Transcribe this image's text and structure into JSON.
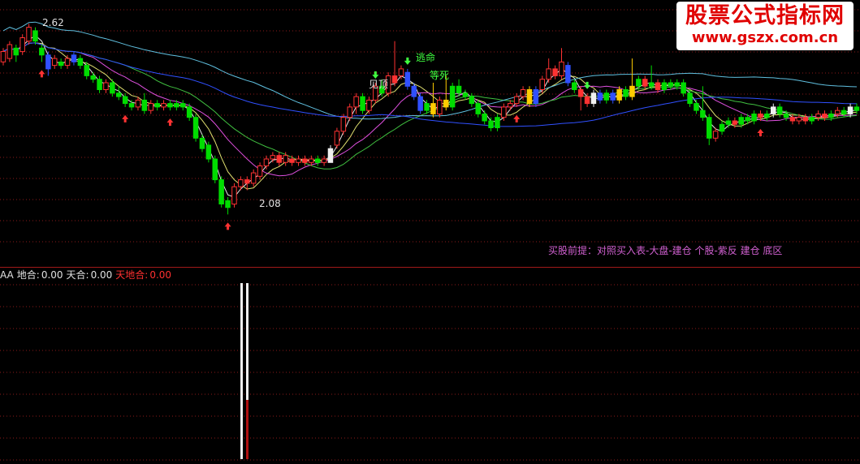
{
  "colors": {
    "up": "#ff3232",
    "down": "#00dd00",
    "grid": "#8b1a1a",
    "ma_white": "#e8e8e8",
    "ma_yellow": "#e0e070",
    "ma_magenta": "#e050e0",
    "ma_green": "#40c040",
    "ma_blue": "#3050ff",
    "ma_cyan": "#60c0e0",
    "signal_blue": "#3050ff",
    "signal_yellow": "#ffcc00",
    "text_green": "#40ff40",
    "text_purple": "#d060d0"
  },
  "main_chart": {
    "high_label": "2.62",
    "low_label": "2.08",
    "annotation_escape": "逃命",
    "annotation_wait_death": "等死",
    "annotation_top": "见顶",
    "buy_premise": "买股前提：对照买入表-大盘-建仓  个股-紫反 建仓 底区"
  },
  "indicator": {
    "name": "AA",
    "items": [
      {
        "label": "地合:",
        "value": "0.00",
        "color": "#e0e0e0"
      },
      {
        "label": "天合:",
        "value": "0.00",
        "color": "#e0e0e0"
      },
      {
        "label": "天地合:",
        "value": "0.00",
        "color": "#ff3030"
      }
    ]
  },
  "watermark": {
    "title": "股票公式指标网",
    "url": "www.gszx.com.cn"
  },
  "chart_data": {
    "type": "candlestick",
    "high": 2.62,
    "low": 2.08,
    "candles": [
      {
        "o": 2.52,
        "c": 2.55,
        "h": 2.56,
        "l": 2.51,
        "s": "up"
      },
      {
        "o": 2.53,
        "c": 2.57,
        "h": 2.58,
        "l": 2.52,
        "s": "up"
      },
      {
        "o": 2.56,
        "c": 2.54,
        "h": 2.57,
        "l": 2.52,
        "s": "down"
      },
      {
        "o": 2.55,
        "c": 2.59,
        "h": 2.6,
        "l": 2.54,
        "s": "up"
      },
      {
        "o": 2.58,
        "c": 2.62,
        "h": 2.63,
        "l": 2.57,
        "s": "up"
      },
      {
        "o": 2.61,
        "c": 2.58,
        "h": 2.62,
        "l": 2.57,
        "s": "down"
      },
      {
        "o": 2.56,
        "c": 2.54,
        "h": 2.57,
        "l": 2.52,
        "s": "down"
      },
      {
        "o": 2.54,
        "c": 2.5,
        "h": 2.55,
        "l": 2.48,
        "s": "blue"
      },
      {
        "o": 2.51,
        "c": 2.53,
        "h": 2.54,
        "l": 2.5,
        "s": "up"
      },
      {
        "o": 2.52,
        "c": 2.51,
        "h": 2.53,
        "l": 2.5,
        "s": "down"
      },
      {
        "o": 2.51,
        "c": 2.53,
        "h": 2.54,
        "l": 2.5,
        "s": "up"
      },
      {
        "o": 2.52,
        "c": 2.54,
        "h": 2.55,
        "l": 2.51,
        "s": "blue"
      },
      {
        "o": 2.53,
        "c": 2.51,
        "h": 2.54,
        "l": 2.5,
        "s": "down"
      },
      {
        "o": 2.51,
        "c": 2.48,
        "h": 2.52,
        "l": 2.47,
        "s": "down"
      },
      {
        "o": 2.48,
        "c": 2.47,
        "h": 2.49,
        "l": 2.46,
        "s": "down"
      },
      {
        "o": 2.47,
        "c": 2.44,
        "h": 2.48,
        "l": 2.43,
        "s": "down"
      },
      {
        "o": 2.44,
        "c": 2.46,
        "h": 2.47,
        "l": 2.43,
        "s": "up"
      },
      {
        "o": 2.46,
        "c": 2.43,
        "h": 2.47,
        "l": 2.42,
        "s": "down"
      },
      {
        "o": 2.43,
        "c": 2.42,
        "h": 2.45,
        "l": 2.41,
        "s": "down"
      },
      {
        "o": 2.42,
        "c": 2.4,
        "h": 2.43,
        "l": 2.39,
        "s": "down"
      },
      {
        "o": 2.4,
        "c": 2.39,
        "h": 2.41,
        "l": 2.38,
        "s": "down"
      },
      {
        "o": 2.39,
        "c": 2.41,
        "h": 2.42,
        "l": 2.38,
        "s": "up"
      },
      {
        "o": 2.41,
        "c": 2.38,
        "h": 2.43,
        "l": 2.37,
        "s": "down"
      },
      {
        "o": 2.38,
        "c": 2.4,
        "h": 2.41,
        "l": 2.37,
        "s": "up"
      },
      {
        "o": 2.4,
        "c": 2.39,
        "h": 2.41,
        "l": 2.38,
        "s": "down"
      },
      {
        "o": 2.39,
        "c": 2.4,
        "h": 2.41,
        "l": 2.38,
        "s": "up"
      },
      {
        "o": 2.4,
        "c": 2.39,
        "h": 2.41,
        "l": 2.38,
        "s": "down"
      },
      {
        "o": 2.39,
        "c": 2.4,
        "h": 2.41,
        "l": 2.38,
        "s": "down"
      },
      {
        "o": 2.4,
        "c": 2.39,
        "h": 2.41,
        "l": 2.38,
        "s": "down"
      },
      {
        "o": 2.39,
        "c": 2.36,
        "h": 2.4,
        "l": 2.35,
        "s": "down"
      },
      {
        "o": 2.36,
        "c": 2.3,
        "h": 2.37,
        "l": 2.29,
        "s": "down"
      },
      {
        "o": 2.3,
        "c": 2.27,
        "h": 2.31,
        "l": 2.26,
        "s": "down"
      },
      {
        "o": 2.28,
        "c": 2.24,
        "h": 2.29,
        "l": 2.23,
        "s": "down"
      },
      {
        "o": 2.24,
        "c": 2.18,
        "h": 2.25,
        "l": 2.17,
        "s": "down"
      },
      {
        "o": 2.18,
        "c": 2.11,
        "h": 2.19,
        "l": 2.1,
        "s": "down"
      },
      {
        "o": 2.1,
        "c": 2.12,
        "h": 2.13,
        "l": 2.08,
        "s": "down"
      },
      {
        "o": 2.11,
        "c": 2.16,
        "h": 2.17,
        "l": 2.1,
        "s": "up"
      },
      {
        "o": 2.16,
        "c": 2.18,
        "h": 2.19,
        "l": 2.15,
        "s": "up"
      },
      {
        "o": 2.18,
        "c": 2.17,
        "h": 2.19,
        "l": 2.15,
        "s": "up"
      },
      {
        "o": 2.17,
        "c": 2.2,
        "h": 2.21,
        "l": 2.16,
        "s": "up"
      },
      {
        "o": 2.19,
        "c": 2.22,
        "h": 2.23,
        "l": 2.18,
        "s": "up"
      },
      {
        "o": 2.22,
        "c": 2.24,
        "h": 2.25,
        "l": 2.21,
        "s": "up"
      },
      {
        "o": 2.24,
        "c": 2.25,
        "h": 2.26,
        "l": 2.23,
        "s": "up"
      },
      {
        "o": 2.25,
        "c": 2.23,
        "h": 2.26,
        "l": 2.22,
        "s": "up"
      },
      {
        "o": 2.23,
        "c": 2.25,
        "h": 2.26,
        "l": 2.22,
        "s": "up"
      },
      {
        "o": 2.24,
        "c": 2.23,
        "h": 2.25,
        "l": 2.22,
        "s": "up"
      },
      {
        "o": 2.23,
        "c": 2.24,
        "h": 2.25,
        "l": 2.22,
        "s": "up"
      },
      {
        "o": 2.24,
        "c": 2.23,
        "h": 2.25,
        "l": 2.22,
        "s": "up"
      },
      {
        "o": 2.23,
        "c": 2.24,
        "h": 2.25,
        "l": 2.22,
        "s": "up"
      },
      {
        "o": 2.24,
        "c": 2.23,
        "h": 2.25,
        "l": 2.22,
        "s": "down"
      },
      {
        "o": 2.23,
        "c": 2.24,
        "h": 2.25,
        "l": 2.22,
        "s": "up"
      },
      {
        "o": 2.23,
        "c": 2.27,
        "h": 2.28,
        "l": 2.23,
        "s": "white"
      },
      {
        "o": 2.28,
        "c": 2.32,
        "h": 2.33,
        "l": 2.27,
        "s": "up"
      },
      {
        "o": 2.32,
        "c": 2.36,
        "h": 2.37,
        "l": 2.31,
        "s": "up"
      },
      {
        "o": 2.36,
        "c": 2.39,
        "h": 2.4,
        "l": 2.35,
        "s": "up"
      },
      {
        "o": 2.39,
        "c": 2.42,
        "h": 2.43,
        "l": 2.37,
        "s": "up"
      },
      {
        "o": 2.42,
        "c": 2.38,
        "h": 2.43,
        "l": 2.37,
        "s": "down"
      },
      {
        "o": 2.38,
        "c": 2.41,
        "h": 2.42,
        "l": 2.37,
        "s": "up"
      },
      {
        "o": 2.41,
        "c": 2.45,
        "h": 2.46,
        "l": 2.4,
        "s": "up"
      },
      {
        "o": 2.45,
        "c": 2.43,
        "h": 2.47,
        "l": 2.42,
        "s": "down"
      },
      {
        "o": 2.43,
        "c": 2.48,
        "h": 2.49,
        "l": 2.42,
        "s": "up"
      },
      {
        "o": 2.48,
        "c": 2.46,
        "h": 2.58,
        "l": 2.45,
        "s": "up"
      },
      {
        "o": 2.48,
        "c": 2.5,
        "h": 2.51,
        "l": 2.47,
        "s": "up"
      },
      {
        "o": 2.49,
        "c": 2.45,
        "h": 2.5,
        "l": 2.44,
        "s": "blue"
      },
      {
        "o": 2.45,
        "c": 2.42,
        "h": 2.46,
        "l": 2.41,
        "s": "blue"
      },
      {
        "o": 2.42,
        "c": 2.38,
        "h": 2.43,
        "l": 2.37,
        "s": "blue"
      },
      {
        "o": 2.38,
        "c": 2.4,
        "h": 2.41,
        "l": 2.37,
        "s": "down"
      },
      {
        "o": 2.4,
        "c": 2.37,
        "h": 2.46,
        "l": 2.36,
        "s": "yellow"
      },
      {
        "o": 2.37,
        "c": 2.41,
        "h": 2.42,
        "l": 2.36,
        "s": "up"
      },
      {
        "o": 2.41,
        "c": 2.39,
        "h": 2.48,
        "l": 2.38,
        "s": "yellow"
      },
      {
        "o": 2.39,
        "c": 2.45,
        "h": 2.46,
        "l": 2.38,
        "s": "down"
      },
      {
        "o": 2.45,
        "c": 2.43,
        "h": 2.47,
        "l": 2.42,
        "s": "down"
      },
      {
        "o": 2.43,
        "c": 2.42,
        "h": 2.44,
        "l": 2.41,
        "s": "down"
      },
      {
        "o": 2.42,
        "c": 2.4,
        "h": 2.43,
        "l": 2.39,
        "s": "down"
      },
      {
        "o": 2.4,
        "c": 2.37,
        "h": 2.41,
        "l": 2.36,
        "s": "down"
      },
      {
        "o": 2.37,
        "c": 2.35,
        "h": 2.38,
        "l": 2.34,
        "s": "down"
      },
      {
        "o": 2.35,
        "c": 2.33,
        "h": 2.36,
        "l": 2.32,
        "s": "down"
      },
      {
        "o": 2.33,
        "c": 2.36,
        "h": 2.37,
        "l": 2.32,
        "s": "down"
      },
      {
        "o": 2.36,
        "c": 2.39,
        "h": 2.4,
        "l": 2.35,
        "s": "up"
      },
      {
        "o": 2.39,
        "c": 2.4,
        "h": 2.41,
        "l": 2.38,
        "s": "up"
      },
      {
        "o": 2.4,
        "c": 2.42,
        "h": 2.43,
        "l": 2.39,
        "s": "up"
      },
      {
        "o": 2.42,
        "c": 2.44,
        "h": 2.45,
        "l": 2.41,
        "s": "up"
      },
      {
        "o": 2.44,
        "c": 2.4,
        "h": 2.45,
        "l": 2.39,
        "s": "yellow"
      },
      {
        "o": 2.4,
        "c": 2.44,
        "h": 2.45,
        "l": 2.39,
        "s": "blue"
      },
      {
        "o": 2.44,
        "c": 2.47,
        "h": 2.48,
        "l": 2.43,
        "s": "up"
      },
      {
        "o": 2.47,
        "c": 2.5,
        "h": 2.53,
        "l": 2.46,
        "s": "up"
      },
      {
        "o": 2.5,
        "c": 2.48,
        "h": 2.51,
        "l": 2.47,
        "s": "up"
      },
      {
        "o": 2.48,
        "c": 2.52,
        "h": 2.56,
        "l": 2.47,
        "s": "up"
      },
      {
        "o": 2.51,
        "c": 2.46,
        "h": 2.52,
        "l": 2.45,
        "s": "blue"
      },
      {
        "o": 2.46,
        "c": 2.44,
        "h": 2.47,
        "l": 2.43,
        "s": "down"
      },
      {
        "o": 2.44,
        "c": 2.42,
        "h": 2.45,
        "l": 2.38,
        "s": "up"
      },
      {
        "o": 2.42,
        "c": 2.4,
        "h": 2.43,
        "l": 2.39,
        "s": "up"
      },
      {
        "o": 2.4,
        "c": 2.43,
        "h": 2.44,
        "l": 2.39,
        "s": "white"
      },
      {
        "o": 2.43,
        "c": 2.41,
        "h": 2.44,
        "l": 2.4,
        "s": "blue"
      },
      {
        "o": 2.41,
        "c": 2.43,
        "h": 2.44,
        "l": 2.4,
        "s": "down"
      },
      {
        "o": 2.43,
        "c": 2.41,
        "h": 2.44,
        "l": 2.4,
        "s": "blue"
      },
      {
        "o": 2.41,
        "c": 2.44,
        "h": 2.45,
        "l": 2.4,
        "s": "yellow"
      },
      {
        "o": 2.44,
        "c": 2.42,
        "h": 2.45,
        "l": 2.41,
        "s": "down"
      },
      {
        "o": 2.42,
        "c": 2.45,
        "h": 2.53,
        "l": 2.41,
        "s": "yellow"
      },
      {
        "o": 2.45,
        "c": 2.47,
        "h": 2.48,
        "l": 2.44,
        "s": "down"
      },
      {
        "o": 2.47,
        "c": 2.45,
        "h": 2.48,
        "l": 2.44,
        "s": "up"
      },
      {
        "o": 2.45,
        "c": 2.46,
        "h": 2.51,
        "l": 2.44,
        "s": "down"
      },
      {
        "o": 2.46,
        "c": 2.44,
        "h": 2.47,
        "l": 2.43,
        "s": "up"
      },
      {
        "o": 2.44,
        "c": 2.46,
        "h": 2.47,
        "l": 2.43,
        "s": "down"
      },
      {
        "o": 2.46,
        "c": 2.45,
        "h": 2.47,
        "l": 2.44,
        "s": "down"
      },
      {
        "o": 2.45,
        "c": 2.46,
        "h": 2.47,
        "l": 2.44,
        "s": "down"
      },
      {
        "o": 2.46,
        "c": 2.43,
        "h": 2.47,
        "l": 2.42,
        "s": "down"
      },
      {
        "o": 2.43,
        "c": 2.4,
        "h": 2.44,
        "l": 2.39,
        "s": "down"
      },
      {
        "o": 2.4,
        "c": 2.38,
        "h": 2.41,
        "l": 2.37,
        "s": "down"
      },
      {
        "o": 2.38,
        "c": 2.36,
        "h": 2.45,
        "l": 2.35,
        "s": "down"
      },
      {
        "o": 2.36,
        "c": 2.3,
        "h": 2.37,
        "l": 2.28,
        "s": "down"
      },
      {
        "o": 2.3,
        "c": 2.32,
        "h": 2.33,
        "l": 2.29,
        "s": "up"
      },
      {
        "o": 2.32,
        "c": 2.34,
        "h": 2.35,
        "l": 2.31,
        "s": "down"
      },
      {
        "o": 2.34,
        "c": 2.35,
        "h": 2.36,
        "l": 2.33,
        "s": "down"
      },
      {
        "o": 2.35,
        "c": 2.34,
        "h": 2.36,
        "l": 2.33,
        "s": "up"
      },
      {
        "o": 2.34,
        "c": 2.36,
        "h": 2.37,
        "l": 2.33,
        "s": "down"
      },
      {
        "o": 2.36,
        "c": 2.35,
        "h": 2.37,
        "l": 2.34,
        "s": "down"
      },
      {
        "o": 2.35,
        "c": 2.37,
        "h": 2.38,
        "l": 2.34,
        "s": "down"
      },
      {
        "o": 2.37,
        "c": 2.36,
        "h": 2.38,
        "l": 2.35,
        "s": "up"
      },
      {
        "o": 2.36,
        "c": 2.37,
        "h": 2.38,
        "l": 2.35,
        "s": "down"
      },
      {
        "o": 2.37,
        "c": 2.39,
        "h": 2.4,
        "l": 2.36,
        "s": "white"
      },
      {
        "o": 2.39,
        "c": 2.37,
        "h": 2.4,
        "l": 2.36,
        "s": "down"
      },
      {
        "o": 2.37,
        "c": 2.36,
        "h": 2.38,
        "l": 2.35,
        "s": "down"
      },
      {
        "o": 2.36,
        "c": 2.35,
        "h": 2.37,
        "l": 2.34,
        "s": "up"
      },
      {
        "o": 2.35,
        "c": 2.36,
        "h": 2.37,
        "l": 2.34,
        "s": "up"
      },
      {
        "o": 2.36,
        "c": 2.35,
        "h": 2.37,
        "l": 2.34,
        "s": "up"
      },
      {
        "o": 2.35,
        "c": 2.36,
        "h": 2.37,
        "l": 2.34,
        "s": "down"
      },
      {
        "o": 2.36,
        "c": 2.37,
        "h": 2.38,
        "l": 2.35,
        "s": "up"
      },
      {
        "o": 2.37,
        "c": 2.36,
        "h": 2.38,
        "l": 2.35,
        "s": "up"
      },
      {
        "o": 2.36,
        "c": 2.37,
        "h": 2.38,
        "l": 2.35,
        "s": "down"
      },
      {
        "o": 2.37,
        "c": 2.38,
        "h": 2.39,
        "l": 2.36,
        "s": "up"
      },
      {
        "o": 2.38,
        "c": 2.37,
        "h": 2.39,
        "l": 2.36,
        "s": "down"
      },
      {
        "o": 2.37,
        "c": 2.39,
        "h": 2.4,
        "l": 2.36,
        "s": "white"
      },
      {
        "o": 2.39,
        "c": 2.38,
        "h": 2.4,
        "l": 2.37,
        "s": "down"
      }
    ],
    "up_arrow_candles": [
      6,
      19,
      26,
      35,
      80,
      118
    ],
    "down_arrow_candles": [
      58,
      63,
      91
    ],
    "indicator_values": {
      "地合": 0.0,
      "天合": 0.0,
      "天地合": 0.0
    }
  }
}
